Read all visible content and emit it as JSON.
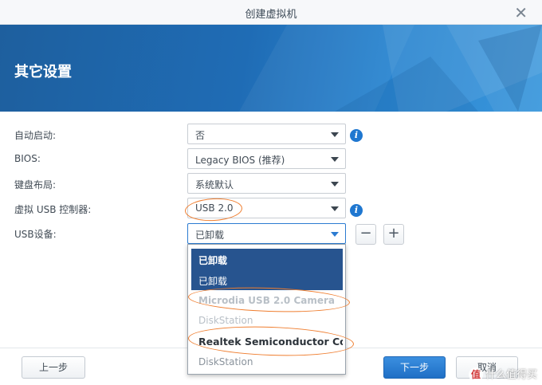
{
  "window": {
    "title": "创建虚拟机"
  },
  "banner": {
    "heading": "其它设置"
  },
  "form": {
    "autostart": {
      "label": "自动启动:",
      "value": "否"
    },
    "bios": {
      "label": "BIOS:",
      "value": "Legacy BIOS (推荐)"
    },
    "keyboard": {
      "label": "键盘布局:",
      "value": "系统默认"
    },
    "usb_controller": {
      "label": "虚拟 USB 控制器:",
      "value": "USB 2.0"
    },
    "usb_device": {
      "label": "USB设备:",
      "value": "已卸载"
    }
  },
  "usb_device_buttons": {
    "remove": "−",
    "add": "+"
  },
  "dropdown": {
    "items": [
      {
        "label": "已卸载"
      },
      {
        "label": "已卸载"
      },
      {
        "label": "Microdia USB 2.0 Camera"
      },
      {
        "label": "DiskStation"
      },
      {
        "label": "Realtek Semiconductor Cor"
      },
      {
        "label": "DiskStation"
      }
    ]
  },
  "footer": {
    "prev": "上一步",
    "next": "下一步",
    "cancel": "取消"
  },
  "watermark": {
    "logo": "值",
    "text": "什么值得买"
  },
  "colors": {
    "accent": "#1f77d0",
    "banner": "#1f6cb5",
    "annotation": "#ef7d2e",
    "selected": "#27548f"
  },
  "icons": {
    "close": "close-icon",
    "info": "info-icon",
    "caret": "chevron-down-icon"
  }
}
